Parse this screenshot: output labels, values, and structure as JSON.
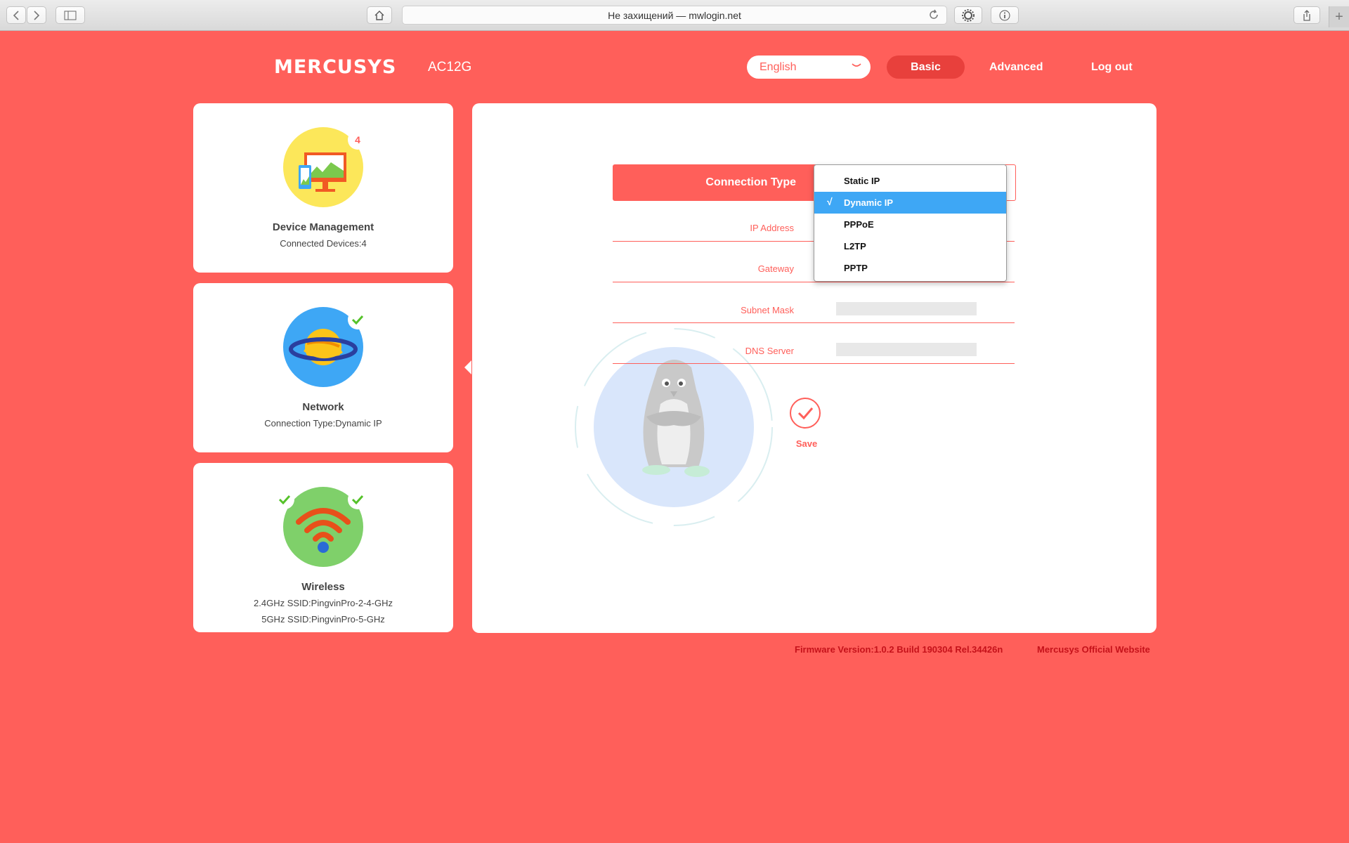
{
  "browser": {
    "url_text": "Не захищений — mwlogin.net"
  },
  "header": {
    "logo": "MERCUSYS",
    "model": "AC12G",
    "language": "English",
    "nav": {
      "basic": "Basic",
      "advanced": "Advanced",
      "logout": "Log out"
    }
  },
  "cards": {
    "device": {
      "title": "Device Management",
      "subtitle": "Connected Devices:4",
      "badge": "4"
    },
    "network": {
      "title": "Network",
      "subtitle": "Connection Type:Dynamic IP"
    },
    "wireless": {
      "title": "Wireless",
      "line1": "2.4GHz SSID:PingvinPro-2-4-GHz",
      "line2": "5GHz SSID:PingvinPro-5-GHz"
    }
  },
  "form": {
    "connection_type_label": "Connection Type",
    "fields": {
      "ip_address": "IP Address",
      "gateway": "Gateway",
      "subnet_mask": "Subnet Mask",
      "dns_server": "DNS Server"
    },
    "dropdown_options": [
      "Static IP",
      "Dynamic IP",
      "PPPoE",
      "L2TP",
      "PPTP"
    ],
    "selected_option": "Dynamic IP",
    "check_mark": "√",
    "save_label": "Save"
  },
  "footer": {
    "firmware": "Firmware Version:1.0.2 Build 190304 Rel.34426n",
    "official_site": "Mercusys Official Website"
  },
  "colors": {
    "background": "#ff5f5a",
    "accent_dark": "#e8403c",
    "selected_option": "#3ea7f5",
    "footer_text": "#c5121a"
  },
  "icons": {
    "device": "monitor-phone-icon",
    "network": "planet-icon",
    "wireless": "wifi-icon",
    "status_ok": "checkmark-icon",
    "save": "checkmark-circle-icon"
  }
}
